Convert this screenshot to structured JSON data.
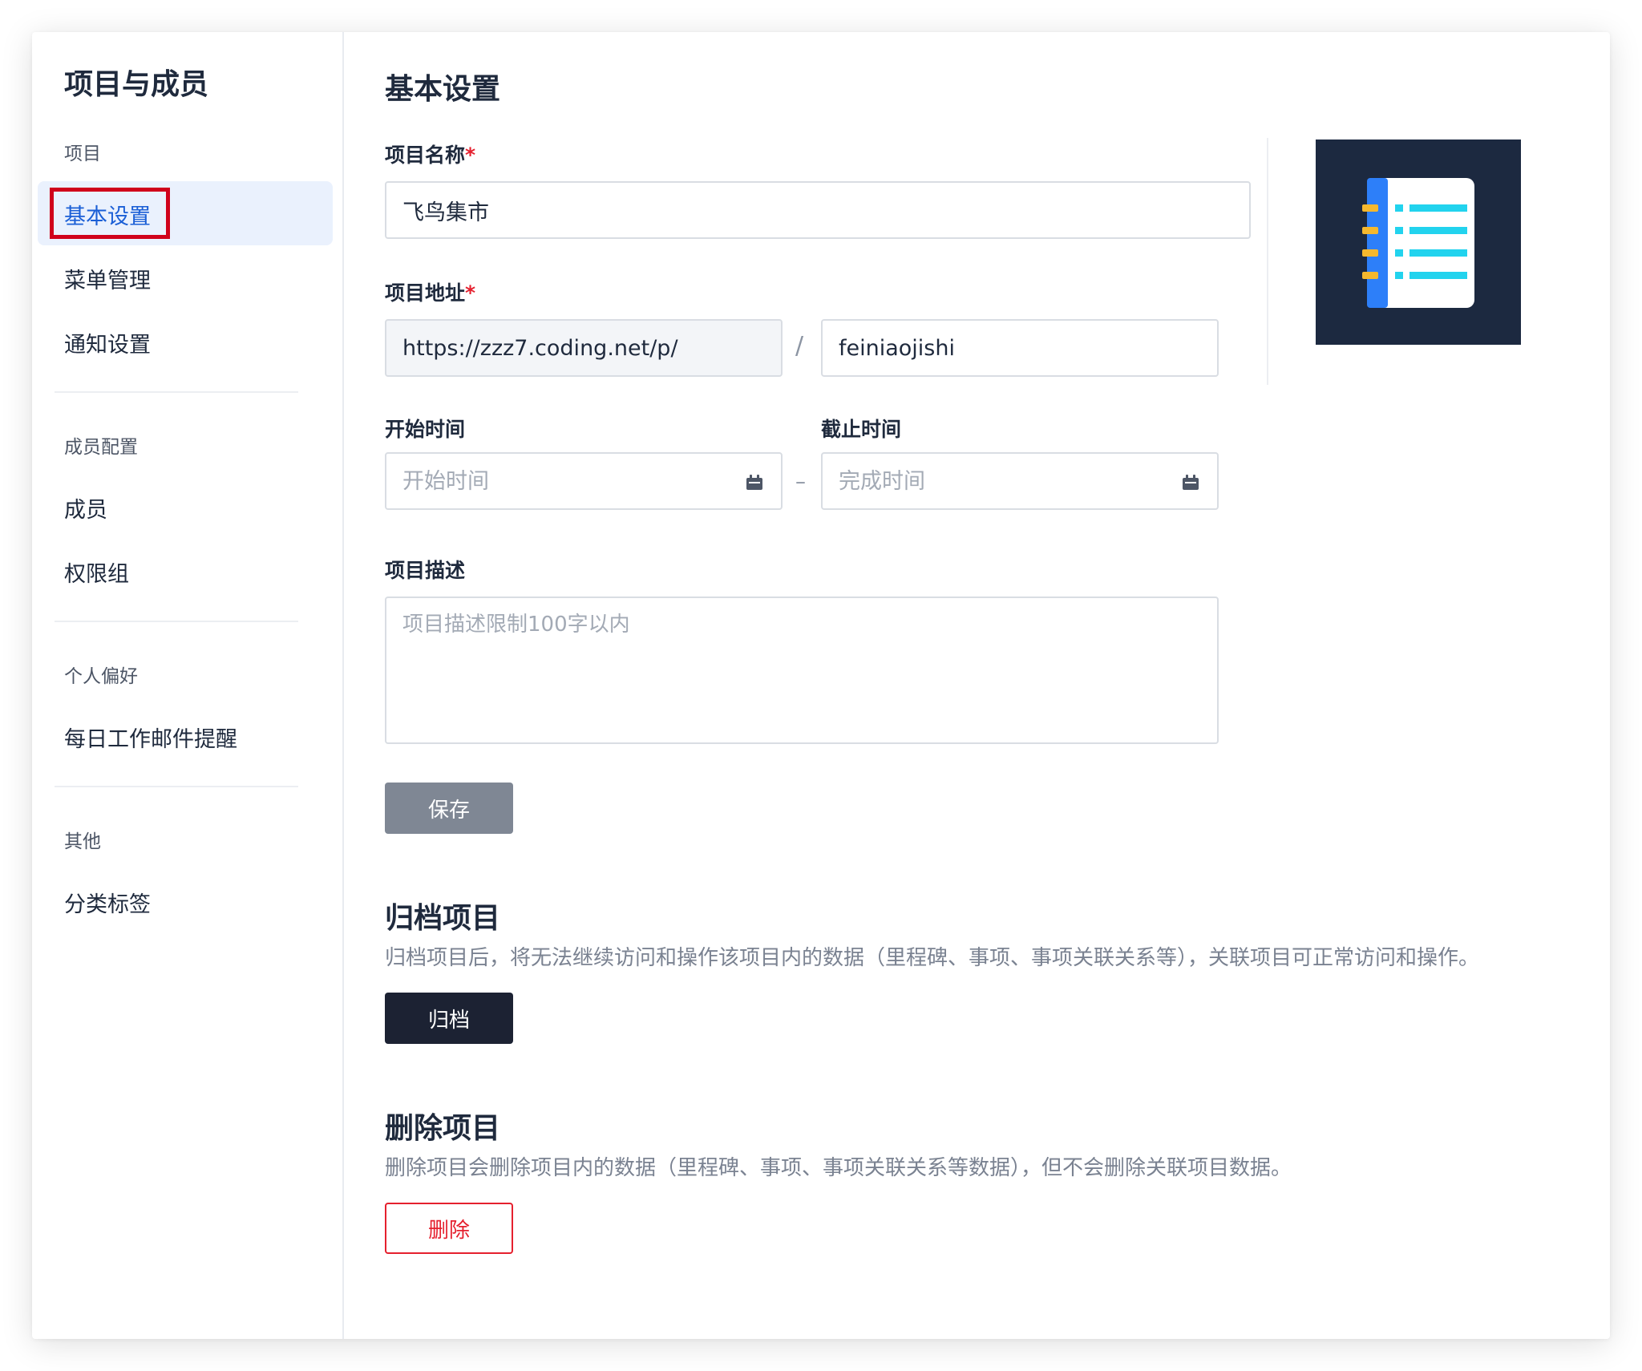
{
  "sidebar": {
    "title": "项目与成员",
    "groups": [
      {
        "label": "项目",
        "items": [
          {
            "label": "基本设置"
          },
          {
            "label": "菜单管理"
          },
          {
            "label": "通知设置"
          }
        ]
      },
      {
        "label": "成员配置",
        "items": [
          {
            "label": "成员"
          },
          {
            "label": "权限组"
          }
        ]
      },
      {
        "label": "个人偏好",
        "items": [
          {
            "label": "每日工作邮件提醒"
          }
        ]
      },
      {
        "label": "其他",
        "items": [
          {
            "label": "分类标签"
          }
        ]
      }
    ],
    "active_item": "基本设置"
  },
  "main": {
    "title": "基本设置",
    "project_name": {
      "label": "项目名称",
      "required_mark": "*",
      "value": "飞鸟集市"
    },
    "project_address": {
      "label": "项目地址",
      "required_mark": "*",
      "prefix": "https://zzz7.coding.net/p/",
      "separator": "/",
      "value": "feiniaojishi"
    },
    "start_time": {
      "label": "开始时间",
      "placeholder": "开始时间"
    },
    "end_time": {
      "label": "截止时间",
      "placeholder": "完成时间"
    },
    "date_separator": "–",
    "description": {
      "label": "项目描述",
      "placeholder": "项目描述限制100字以内"
    },
    "save_label": "保存",
    "archive": {
      "title": "归档项目",
      "desc": "归档项目后，将无法继续访问和操作该项目内的数据（里程碑、事项、事项关联关系等），关联项目可正常访问和操作。",
      "button": "归档"
    },
    "delete": {
      "title": "删除项目",
      "desc": "删除项目会删除项目内的数据（里程碑、事项、事项关联关系等数据），但不会删除关联项目数据。",
      "button": "删除"
    }
  },
  "icons": [
    "project-logo-icon",
    "calendar-icon"
  ],
  "colors": {
    "accent": "#1b5fd6",
    "danger": "#e5202e",
    "highlight_frame": "#d0021b",
    "logo_bg": "#1c2940",
    "logo_cyan": "#22d3ee",
    "logo_blue": "#2d7ff9",
    "logo_yellow": "#f5b82e"
  }
}
